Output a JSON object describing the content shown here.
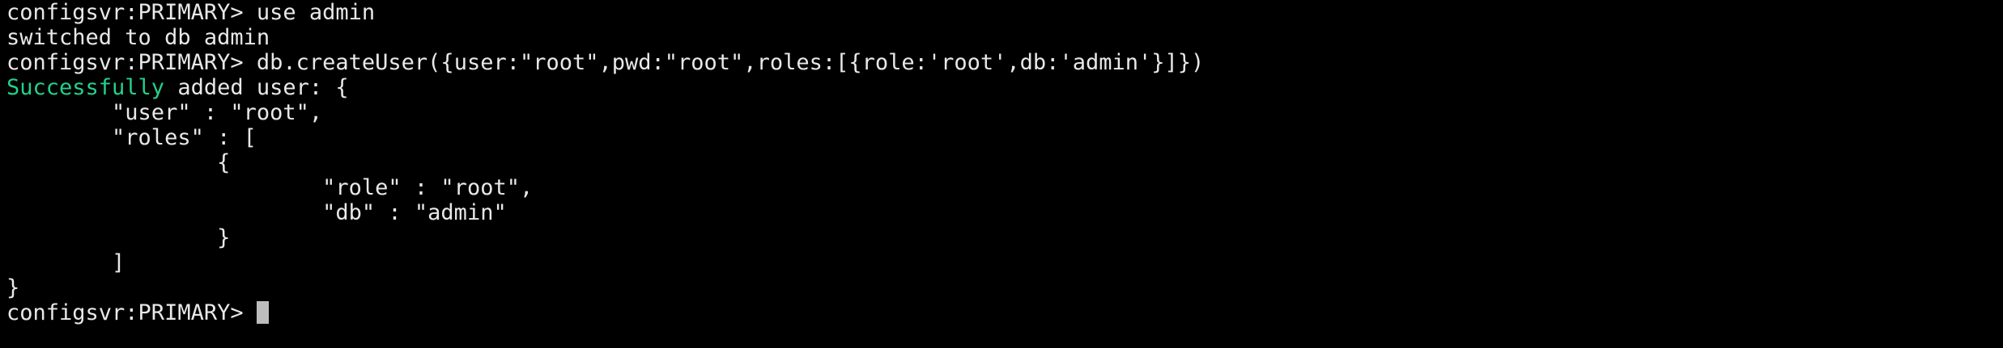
{
  "terminal": {
    "lines": [
      {
        "prompt": "configsvr:PRIMARY> ",
        "command": "use admin"
      },
      {
        "output": "switched to db admin"
      },
      {
        "prompt": "configsvr:PRIMARY> ",
        "command": "db.createUser({user:\"root\",pwd:\"root\",roles:[{role:'root',db:'admin'}]})"
      },
      {
        "success_word": "Successfully",
        "output": " added user: {"
      },
      {
        "output": "        \"user\" : \"root\","
      },
      {
        "output": "        \"roles\" : ["
      },
      {
        "output": "                {"
      },
      {
        "output": "                        \"role\" : \"root\","
      },
      {
        "output": "                        \"db\" : \"admin\""
      },
      {
        "output": "                }"
      },
      {
        "output": "        ]"
      },
      {
        "output": "}"
      },
      {
        "prompt": "configsvr:PRIMARY> ",
        "command": ""
      }
    ]
  },
  "colors": {
    "background": "#000000",
    "text": "#e8e8e8",
    "success": "#23d18b",
    "cursor": "#bdbdbd"
  }
}
